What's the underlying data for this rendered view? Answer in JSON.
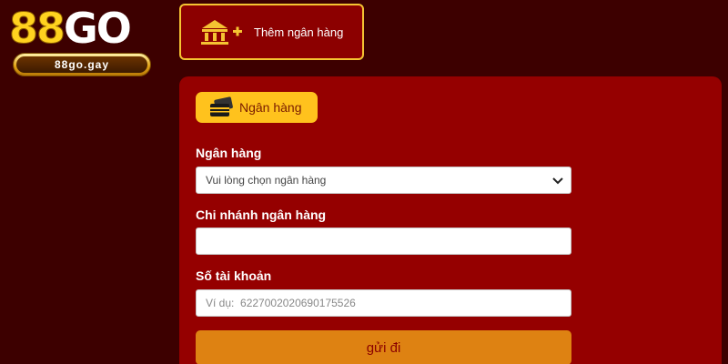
{
  "logo": {
    "brand_digits": "88",
    "brand_letters": "GO",
    "domain": "88go.gay"
  },
  "add_bank_button": {
    "label": "Thêm ngân hàng",
    "icon": "bank-add-icon"
  },
  "panel": {
    "tab": {
      "label": "Ngân hàng",
      "icon": "card-icon"
    },
    "fields": {
      "bank": {
        "label": "Ngân hàng",
        "value": "Vui lòng chọn ngân hàng"
      },
      "branch": {
        "label": "Chi nhánh ngân hàng",
        "value": ""
      },
      "account": {
        "label": "Số tài khoản",
        "placeholder": "Ví dụ:  6227002020690175526"
      }
    },
    "submit_label": "gửi đi"
  },
  "colors": {
    "background": "#3d0000",
    "panel": "#950000",
    "accent_gold": "#ffc21d",
    "submit": "#de8212"
  }
}
